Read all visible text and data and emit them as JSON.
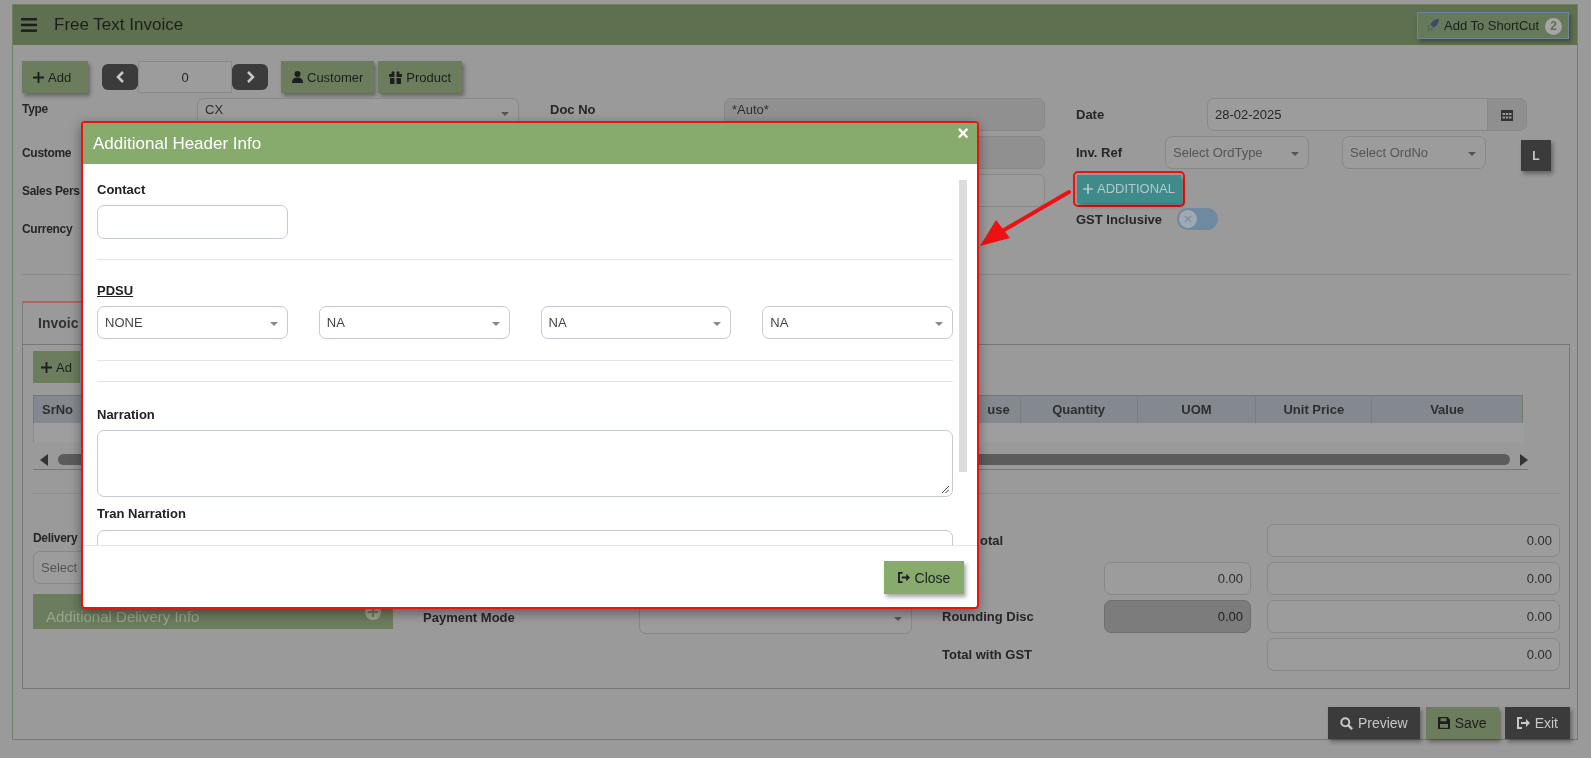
{
  "header": {
    "title": "Free Text Invoice",
    "shortcut_button": "Add To ShortCut",
    "shortcut_badge": "2"
  },
  "toolbar": {
    "add_button": "Add",
    "page_number": "0",
    "customer_button": "Customer",
    "product_button": "Product"
  },
  "form": {
    "type": {
      "label": "Type",
      "value": "CX"
    },
    "customer_label": "Custome",
    "sales_person_label": "Sales Pers",
    "currency_label": "Currency",
    "doc_no": {
      "label": "Doc No",
      "value": "*Auto*"
    },
    "date": {
      "label": "Date",
      "value": "28-02-2025"
    },
    "inv_ref": {
      "label": "Inv. Ref",
      "order_type_placeholder": "Select OrdType",
      "order_no_placeholder": "Select OrdNo"
    },
    "l_button": "L",
    "additional_button": "ADDITIONAL",
    "gst_inclusive": {
      "label": "GST Inclusive",
      "on": false
    }
  },
  "tabs": [
    {
      "label": "Invoic",
      "selected": true
    }
  ],
  "items": {
    "add_button": "Ad",
    "columns": [
      "SrNo",
      "use",
      "Quantity",
      "UOM",
      "Unit Price",
      "Value"
    ]
  },
  "delivery": {
    "label": "Delivery",
    "placeholder": "Select",
    "info_bar": "Additional Delivery Info"
  },
  "payment_mode": {
    "label": "Payment Mode"
  },
  "totals": [
    {
      "label": "otal",
      "amount": "0.00"
    },
    {
      "extra": {
        "value": "0.00",
        "disabled": false
      },
      "amount": "0.00"
    },
    {
      "label": "Rounding Disc",
      "extra": {
        "value": "0.00",
        "disabled": true
      },
      "amount": "0.00"
    },
    {
      "label": "Total with GST",
      "amount": "0.00"
    }
  ],
  "footer_buttons": [
    {
      "kind": "preview",
      "label": "Preview"
    },
    {
      "kind": "save",
      "label": "Save"
    },
    {
      "kind": "exit",
      "label": "Exit"
    }
  ],
  "modal": {
    "title": "Additional Header Info",
    "close_symbol": "×",
    "contact": {
      "label": "Contact"
    },
    "pdsu": {
      "label": "PDSU",
      "selects": [
        "NONE",
        "NA",
        "NA",
        "NA"
      ]
    },
    "narration": {
      "label": "Narration"
    },
    "tran_narration": {
      "label": "Tran Narration"
    },
    "close_button": "Close"
  }
}
